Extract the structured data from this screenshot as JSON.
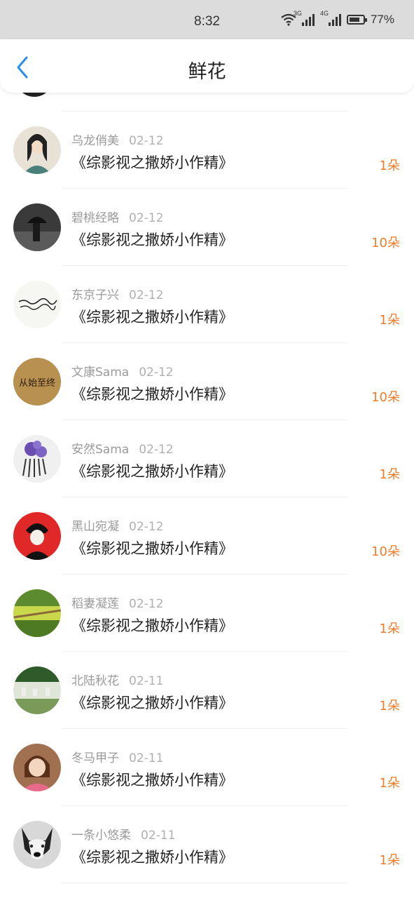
{
  "status_bar": {
    "time": "8:32",
    "net1": "3G",
    "net2": "4G",
    "battery": "77%",
    "battery_level": 0.77
  },
  "header": {
    "title": "鲜花",
    "back_icon": "chevron-left-icon",
    "accent_color": "#2a8ee8"
  },
  "count_color": "#f07b2a",
  "rows": [
    {
      "user": "乌龙俏美",
      "date": "02-12",
      "book": "《综影视之撒娇小作精》",
      "count": "1朵"
    },
    {
      "user": "碧桃经略",
      "date": "02-12",
      "book": "《综影视之撒娇小作精》",
      "count": "10朵"
    },
    {
      "user": "东京子兴",
      "date": "02-12",
      "book": "《综影视之撒娇小作精》",
      "count": "1朵"
    },
    {
      "user": "文康Sama",
      "date": "02-12",
      "book": "《综影视之撒娇小作精》",
      "count": "10朵",
      "avatar_text": "从始至终"
    },
    {
      "user": "安然Sama",
      "date": "02-12",
      "book": "《综影视之撒娇小作精》",
      "count": "1朵"
    },
    {
      "user": "黑山宛凝",
      "date": "02-12",
      "book": "《综影视之撒娇小作精》",
      "count": "10朵"
    },
    {
      "user": "稻妻凝莲",
      "date": "02-12",
      "book": "《综影视之撒娇小作精》",
      "count": "1朵"
    },
    {
      "user": "北陆秋花",
      "date": "02-11",
      "book": "《综影视之撒娇小作精》",
      "count": "1朵"
    },
    {
      "user": "冬马甲子",
      "date": "02-11",
      "book": "《综影视之撒娇小作精》",
      "count": "1朵"
    },
    {
      "user": "一条小悠柔",
      "date": "02-11",
      "book": "《综影视之撒娇小作精》",
      "count": "1朵"
    }
  ]
}
